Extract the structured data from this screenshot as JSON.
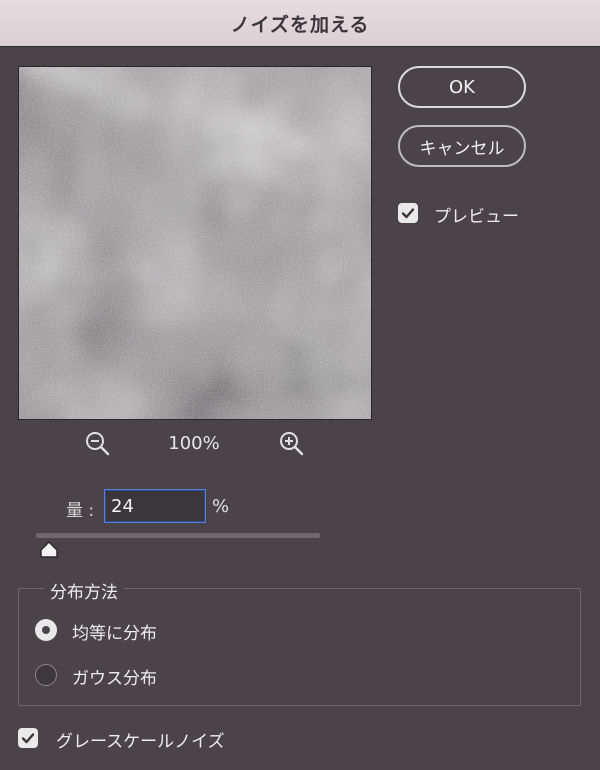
{
  "dialog": {
    "title": "ノイズを加える"
  },
  "buttons": {
    "ok": "OK",
    "cancel": "キャンセル"
  },
  "preview_option": {
    "label": "プレビュー",
    "checked": true
  },
  "zoom": {
    "level": "100%",
    "zoom_out_icon": "zoom-out-icon",
    "zoom_in_icon": "zoom-in-icon"
  },
  "amount": {
    "label": "量 :",
    "value": "24",
    "unit": "%"
  },
  "distribution": {
    "title": "分布方法",
    "options": [
      {
        "label": "均等に分布",
        "selected": true
      },
      {
        "label": "ガウス分布",
        "selected": false
      }
    ]
  },
  "grayscale_option": {
    "label": "グレースケールノイズ",
    "checked": true
  }
}
